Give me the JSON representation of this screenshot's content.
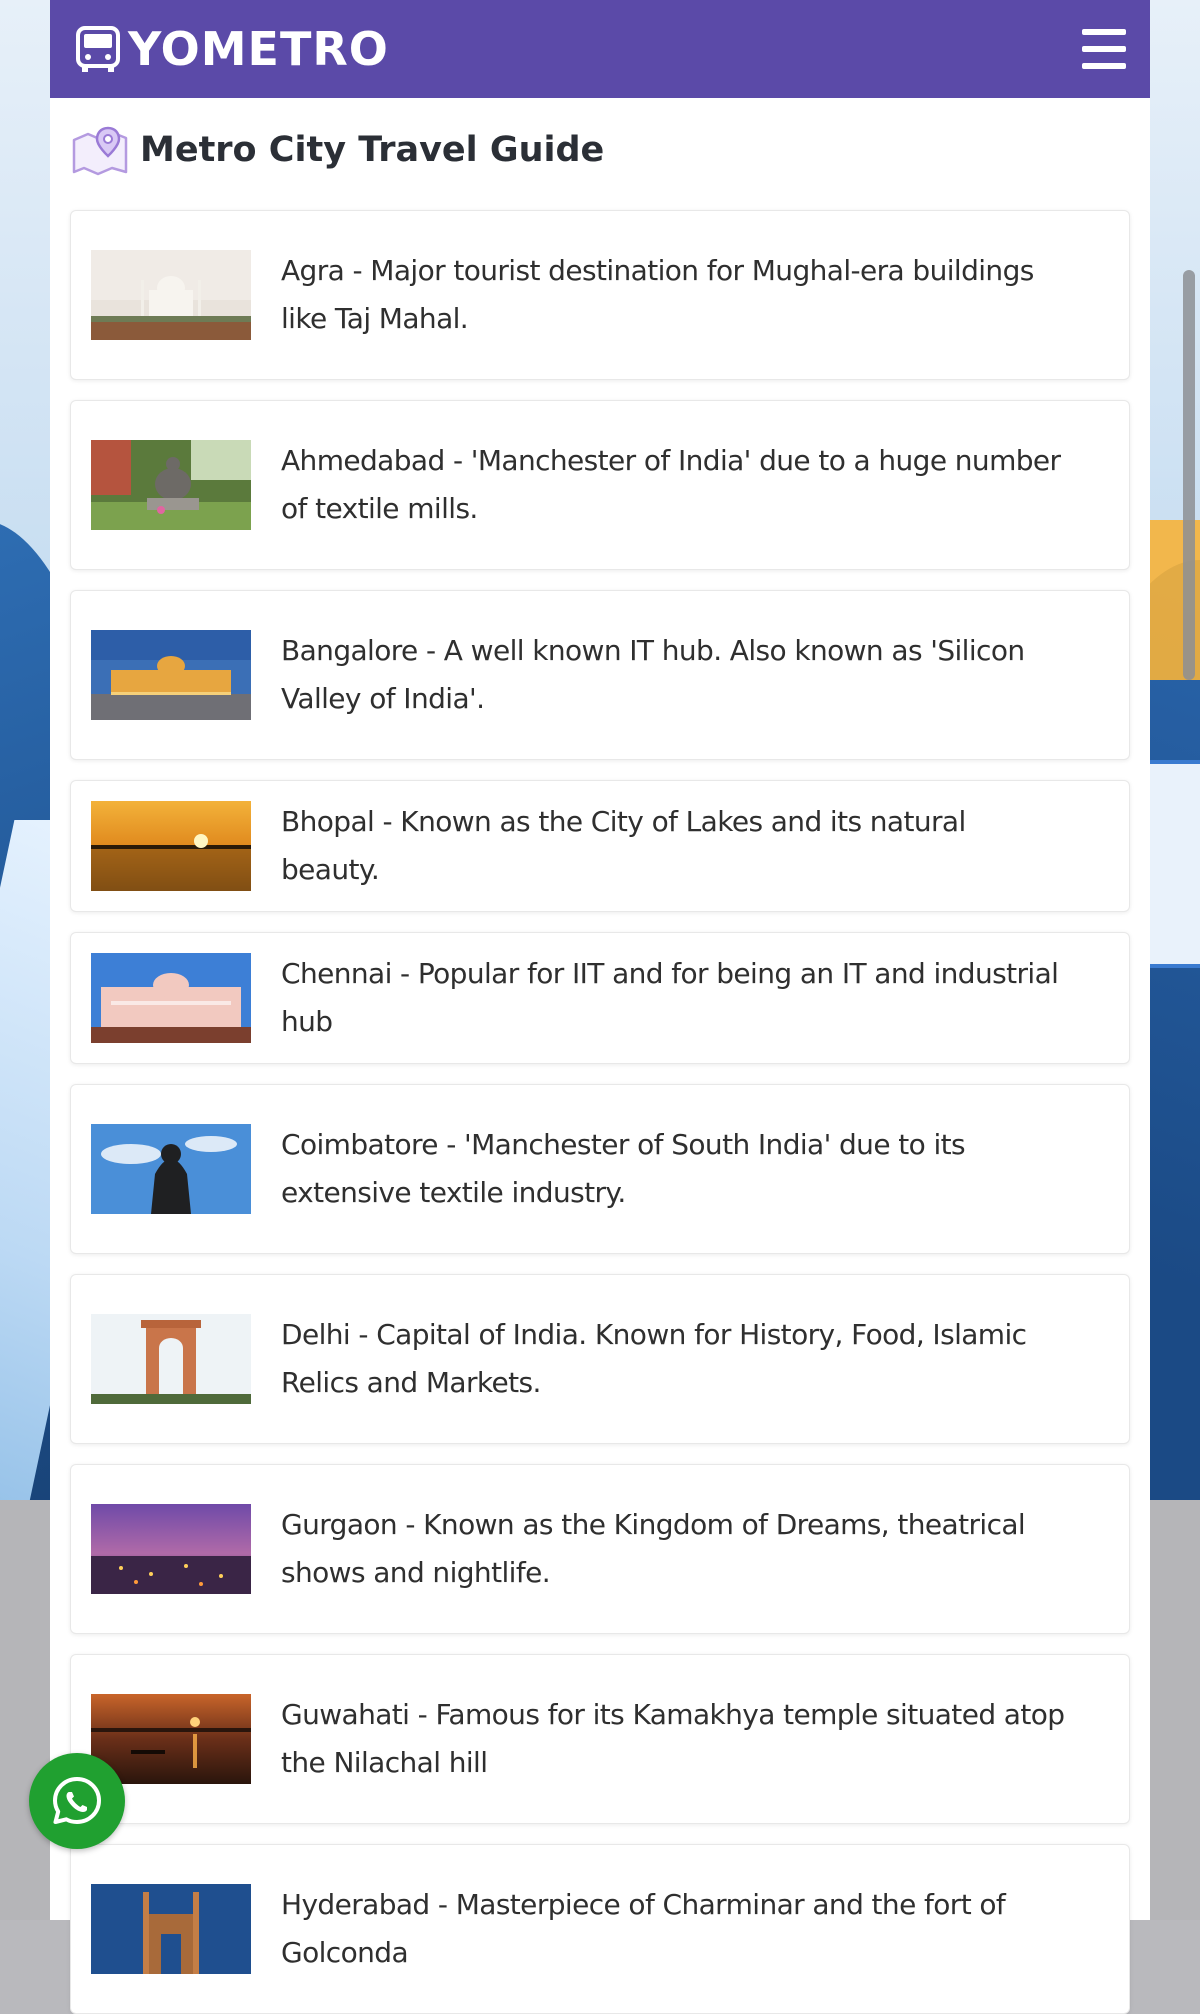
{
  "brand": {
    "name": "YOMETRO",
    "color": "#5b4aa8"
  },
  "page_title": "Metro City Travel Guide",
  "cities": [
    {
      "text": "Agra - Major tourist destination for Mughal-era buildings like Taj Mahal.",
      "image": "taj-mahal"
    },
    {
      "text": "Ahmedabad - 'Manchester of India' due to a huge number of textile mills.",
      "image": "gandhi-statue"
    },
    {
      "text": "Bangalore - A well known IT hub. Also known as 'Silicon Valley of India'.",
      "image": "vidhana-soudha"
    },
    {
      "text": "Bhopal - Known as the City of Lakes and its natural beauty.",
      "image": "lake-sunset"
    },
    {
      "text": "Chennai - Popular for IIT and for being an IT and industrial hub",
      "image": "chennai-building"
    },
    {
      "text": "Coimbatore - 'Manchester of South India' due to its extensive textile industry.",
      "image": "adiyogi-statue"
    },
    {
      "text": "Delhi - Capital of India. Known for History, Food, Islamic Relics and Markets.",
      "image": "india-gate"
    },
    {
      "text": "Gurgaon - Known as the Kingdom of Dreams, theatrical shows and nightlife.",
      "image": "city-night"
    },
    {
      "text": "Guwahati - Famous for its Kamakhya temple situated atop the Nilachal hill",
      "image": "river-sunset"
    },
    {
      "text": "Hyderabad - Masterpiece of Charminar and the fort of Golconda",
      "image": "charminar"
    }
  ],
  "icons": {
    "logo": "bus-icon",
    "menu": "hamburger-menu-icon",
    "header": "map-pin-icon",
    "chat": "whatsapp-icon"
  }
}
